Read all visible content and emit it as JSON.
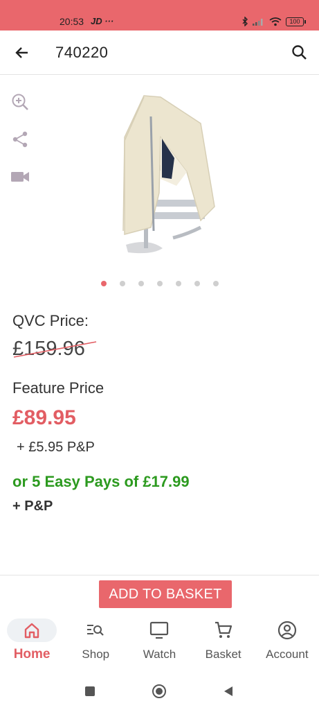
{
  "status_bar": {
    "time": "20:53",
    "left_icons_text": "JD ···",
    "battery": "100"
  },
  "app_bar": {
    "title": "740220"
  },
  "gallery": {
    "dots_count": 7,
    "active_index": 0
  },
  "pricing": {
    "qvc_price_label": "QVC Price:",
    "qvc_price": "£159.96",
    "feature_price_label": "Feature Price",
    "feature_price": "£89.95",
    "pnp": "+ £5.95 P&P",
    "easy_pays": "or 5 Easy Pays of £17.99",
    "easy_pays_pnp": "+ P&P"
  },
  "actions": {
    "add_to_basket": "ADD TO BASKET"
  },
  "bottom_nav": {
    "items": [
      {
        "label": "Home",
        "icon": "home-icon",
        "active": true
      },
      {
        "label": "Shop",
        "icon": "shop-icon",
        "active": false
      },
      {
        "label": "Watch",
        "icon": "tv-icon",
        "active": false
      },
      {
        "label": "Basket",
        "icon": "cart-icon",
        "active": false
      },
      {
        "label": "Account",
        "icon": "account-icon",
        "active": false
      }
    ]
  },
  "colors": {
    "brand": "#e9676c",
    "feature_price": "#e25d63",
    "easy_pays": "#2c9a1f"
  }
}
